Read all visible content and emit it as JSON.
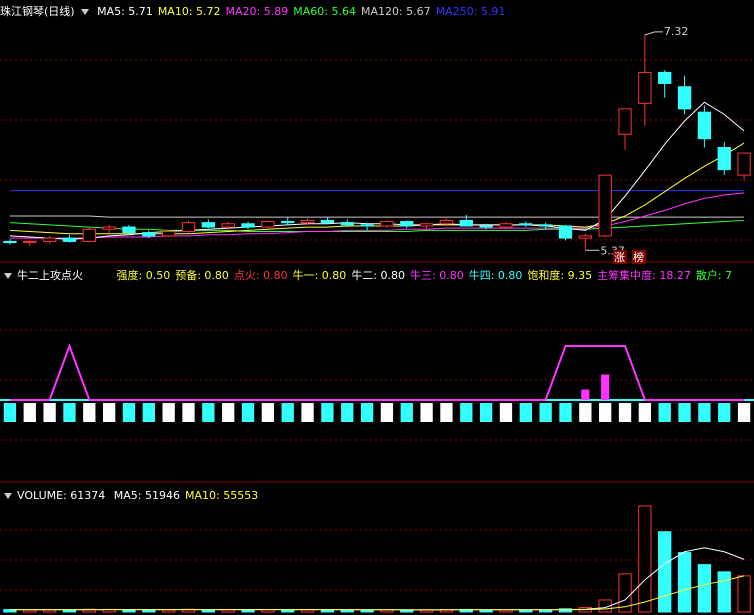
{
  "price_header": {
    "title": "珠江钢琴(日线)",
    "ma": [
      {
        "label": "MA5: 5.71",
        "color": "#ffffff"
      },
      {
        "label": "MA10: 5.72",
        "color": "#ffff33"
      },
      {
        "label": "MA20: 5.89",
        "color": "#ff33ff"
      },
      {
        "label": "MA60: 5.64",
        "color": "#33ff33"
      },
      {
        "label": "MA120: 5.67",
        "color": "#cccccc"
      },
      {
        "label": "MA250: 5.91",
        "color": "#3333ff"
      }
    ]
  },
  "price_annotations": {
    "high": "7.32",
    "low": "5.37",
    "tag1": "涨",
    "tag2": "榜"
  },
  "indicator_header": {
    "title": "牛二上攻点火",
    "params": [
      {
        "label": "强度: 0.50",
        "color": "#ffff33"
      },
      {
        "label": "预备: 0.80",
        "color": "#ffff33"
      },
      {
        "label": "点火: 0.80",
        "color": "#ff3333"
      },
      {
        "label": "牛一: 0.80",
        "color": "#ffff33"
      },
      {
        "label": "牛二: 0.80",
        "color": "#ffffff"
      },
      {
        "label": "牛三: 0.80",
        "color": "#ff33ff"
      },
      {
        "label": "牛四: 0.80",
        "color": "#33ffff"
      },
      {
        "label": "饱和度: 9.35",
        "color": "#ffff33"
      },
      {
        "label": "主筹集中度: 18.27",
        "color": "#ff33ff"
      },
      {
        "label": "散户: 7",
        "color": "#33ff33"
      }
    ]
  },
  "volume_header": {
    "title": "VOLUME: 61374",
    "ma": [
      {
        "label": "MA5: 51946",
        "color": "#ffffff"
      },
      {
        "label": "MA10: 55553",
        "color": "#ffff33"
      }
    ]
  },
  "colors": {
    "up": "#ff3333",
    "down": "#33ffff",
    "grid": "#8b0000",
    "bg": "#000000"
  },
  "chart_data": {
    "type": "candlestick",
    "candles": [
      [
        5.45,
        5.47,
        5.42,
        5.44
      ],
      [
        5.44,
        5.46,
        5.41,
        5.45
      ],
      [
        5.45,
        5.5,
        5.43,
        5.48
      ],
      [
        5.48,
        5.51,
        5.44,
        5.45
      ],
      [
        5.45,
        5.58,
        5.44,
        5.56
      ],
      [
        5.56,
        5.6,
        5.52,
        5.58
      ],
      [
        5.58,
        5.6,
        5.52,
        5.53
      ],
      [
        5.53,
        5.55,
        5.48,
        5.5
      ],
      [
        5.5,
        5.55,
        5.49,
        5.54
      ],
      [
        5.54,
        5.64,
        5.53,
        5.62
      ],
      [
        5.62,
        5.65,
        5.57,
        5.58
      ],
      [
        5.58,
        5.63,
        5.55,
        5.61
      ],
      [
        5.61,
        5.63,
        5.56,
        5.58
      ],
      [
        5.58,
        5.64,
        5.57,
        5.63
      ],
      [
        5.63,
        5.67,
        5.6,
        5.62
      ],
      [
        5.62,
        5.66,
        5.6,
        5.64
      ],
      [
        5.64,
        5.67,
        5.61,
        5.62
      ],
      [
        5.62,
        5.65,
        5.58,
        5.6
      ],
      [
        5.6,
        5.62,
        5.55,
        5.59
      ],
      [
        5.59,
        5.64,
        5.57,
        5.63
      ],
      [
        5.63,
        5.64,
        5.57,
        5.59
      ],
      [
        5.59,
        5.62,
        5.56,
        5.61
      ],
      [
        5.61,
        5.66,
        5.6,
        5.64
      ],
      [
        5.64,
        5.69,
        5.62,
        5.59
      ],
      [
        5.59,
        5.61,
        5.56,
        5.58
      ],
      [
        5.58,
        5.63,
        5.56,
        5.61
      ],
      [
        5.61,
        5.63,
        5.58,
        5.6
      ],
      [
        5.6,
        5.62,
        5.56,
        5.59
      ],
      [
        5.59,
        5.6,
        5.46,
        5.48
      ],
      [
        5.48,
        5.52,
        5.37,
        5.5
      ],
      [
        5.5,
        6.05,
        5.49,
        6.05
      ],
      [
        6.42,
        6.65,
        6.28,
        6.65
      ],
      [
        6.7,
        7.32,
        6.5,
        6.98
      ],
      [
        6.98,
        7.0,
        6.75,
        6.88
      ],
      [
        6.85,
        6.95,
        6.6,
        6.65
      ],
      [
        6.62,
        6.68,
        6.3,
        6.38
      ],
      [
        6.3,
        6.35,
        6.05,
        6.1
      ],
      [
        6.05,
        6.25,
        6.0,
        6.25
      ]
    ],
    "ma5": [
      5.5,
      5.49,
      5.48,
      5.47,
      5.48,
      5.5,
      5.51,
      5.53,
      5.54,
      5.55,
      5.56,
      5.57,
      5.58,
      5.59,
      5.6,
      5.61,
      5.61,
      5.62,
      5.61,
      5.61,
      5.6,
      5.6,
      5.61,
      5.6,
      5.6,
      5.6,
      5.6,
      5.59,
      5.57,
      5.55,
      5.65,
      5.86,
      6.09,
      6.33,
      6.54,
      6.71,
      6.6,
      6.45
    ],
    "ma10": [
      5.55,
      5.54,
      5.53,
      5.52,
      5.52,
      5.52,
      5.52,
      5.52,
      5.52,
      5.52,
      5.53,
      5.54,
      5.55,
      5.56,
      5.57,
      5.58,
      5.58,
      5.59,
      5.59,
      5.59,
      5.59,
      5.6,
      5.6,
      5.6,
      5.6,
      5.6,
      5.6,
      5.6,
      5.59,
      5.58,
      5.61,
      5.68,
      5.78,
      5.9,
      6.02,
      6.13,
      6.23,
      6.34
    ],
    "ma20": [
      5.48,
      5.48,
      5.48,
      5.48,
      5.48,
      5.49,
      5.49,
      5.49,
      5.5,
      5.5,
      5.51,
      5.51,
      5.52,
      5.52,
      5.53,
      5.54,
      5.54,
      5.55,
      5.55,
      5.55,
      5.56,
      5.56,
      5.57,
      5.57,
      5.57,
      5.57,
      5.57,
      5.57,
      5.57,
      5.57,
      5.59,
      5.63,
      5.68,
      5.73,
      5.79,
      5.84,
      5.87,
      5.89
    ],
    "ma60": [
      5.62,
      5.61,
      5.6,
      5.59,
      5.58,
      5.57,
      5.56,
      5.56,
      5.55,
      5.55,
      5.55,
      5.55,
      5.54,
      5.54,
      5.54,
      5.54,
      5.54,
      5.54,
      5.54,
      5.54,
      5.54,
      5.55,
      5.55,
      5.55,
      5.55,
      5.55,
      5.55,
      5.56,
      5.56,
      5.56,
      5.57,
      5.58,
      5.59,
      5.6,
      5.61,
      5.62,
      5.63,
      5.64
    ],
    "ma120": [
      5.68,
      5.68,
      5.68,
      5.68,
      5.68,
      5.67,
      5.67,
      5.67,
      5.67,
      5.67,
      5.67,
      5.67,
      5.67,
      5.67,
      5.67,
      5.67,
      5.67,
      5.67,
      5.67,
      5.67,
      5.67,
      5.67,
      5.67,
      5.67,
      5.67,
      5.67,
      5.67,
      5.67,
      5.67,
      5.67,
      5.67,
      5.67,
      5.67,
      5.67,
      5.67,
      5.67,
      5.67,
      5.67
    ],
    "ma250": [
      5.91,
      5.91,
      5.91,
      5.91,
      5.91,
      5.91,
      5.91,
      5.91,
      5.91,
      5.91,
      5.91,
      5.91,
      5.91,
      5.91,
      5.91,
      5.91,
      5.91,
      5.91,
      5.91,
      5.91,
      5.91,
      5.91,
      5.91,
      5.91,
      5.91,
      5.91,
      5.91,
      5.91,
      5.91,
      5.91,
      5.91,
      5.91,
      5.91,
      5.91,
      5.91,
      5.91,
      5.91,
      5.91
    ],
    "price_range": [
      5.3,
      7.4
    ],
    "indicator_signal": [
      0,
      0,
      0,
      1,
      0,
      0,
      0,
      0,
      0,
      0,
      0,
      0,
      0,
      0,
      0,
      0,
      0,
      0,
      0,
      0,
      0,
      0,
      0,
      0,
      0,
      0,
      0,
      0,
      1,
      1,
      1,
      1,
      0,
      0,
      0,
      0,
      0,
      0
    ],
    "indicator_bars": [
      0,
      0,
      0,
      0,
      0,
      0,
      0,
      0,
      0,
      0,
      0,
      0,
      0,
      0,
      0,
      0,
      0,
      0,
      0,
      0,
      0,
      0,
      0,
      0,
      0,
      0,
      0,
      0,
      0,
      0.35,
      0.85,
      0,
      0,
      0,
      0,
      0,
      0,
      0
    ],
    "volume": [
      6000,
      5000,
      5500,
      5200,
      7000,
      6500,
      5800,
      5000,
      5200,
      6800,
      6000,
      5800,
      5300,
      5900,
      6200,
      5600,
      5100,
      4900,
      5000,
      5600,
      5200,
      4800,
      6100,
      6400,
      5000,
      5200,
      5100,
      4900,
      8000,
      11000,
      30000,
      95000,
      264000,
      200000,
      148000,
      118000,
      100000,
      90000
    ],
    "vol_ma5": [
      5800,
      5700,
      5600,
      5600,
      5700,
      5800,
      5800,
      5800,
      5900,
      5900,
      6000,
      6000,
      5900,
      5800,
      5900,
      5900,
      5800,
      5700,
      5600,
      5500,
      5400,
      5300,
      5400,
      5500,
      5600,
      5500,
      5500,
      5600,
      5900,
      6800,
      11000,
      30000,
      80000,
      120000,
      150000,
      160000,
      150000,
      131000
    ],
    "vol_ma10": [
      6000,
      5900,
      5900,
      5800,
      5800,
      5800,
      5800,
      5800,
      5800,
      5800,
      5800,
      5800,
      5800,
      5800,
      5800,
      5800,
      5800,
      5800,
      5700,
      5700,
      5700,
      5600,
      5600,
      5600,
      5600,
      5600,
      5600,
      5600,
      5700,
      6000,
      7500,
      13000,
      25000,
      40000,
      55000,
      68000,
      78000,
      90000
    ],
    "vol_max": 264000
  }
}
